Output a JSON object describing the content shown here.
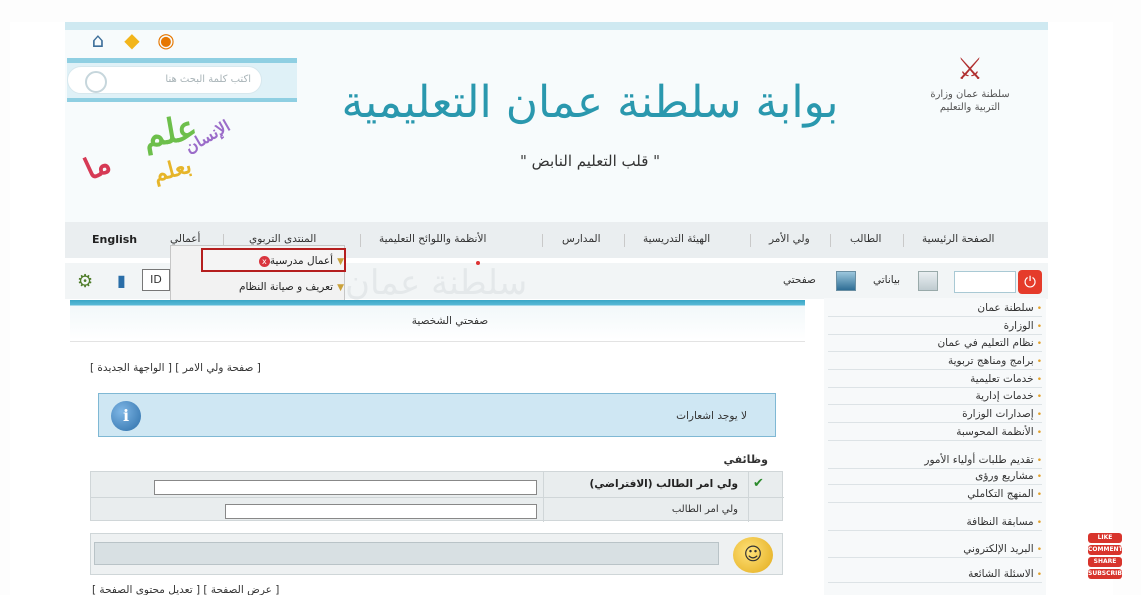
{
  "header": {
    "portal_title": "بوابة سلطنة عمان التعليمية",
    "tagline": "\" قلب التعليم النابض \"",
    "search_placeholder": "اكتب كلمة البحث هنا",
    "ministry_name": "سلطنة عمان وزارة التربية والتعليم",
    "calligraphy": [
      "علم",
      "الإنسان",
      "بعلم",
      "ما"
    ]
  },
  "nav": {
    "english": "English",
    "items": [
      "أعمالي",
      "المنتدى التربوي",
      "الأنظمة واللوائح التعليمية",
      "المدارس",
      "الهيئة التدريسية",
      "ولي الأمر",
      "الطالب",
      "الصفحة الرئيسية"
    ]
  },
  "dropdown": {
    "items": [
      "أعمال مدرسية",
      "تعريف و صيانة النظام"
    ]
  },
  "tools": {
    "my_data": "بياناتي",
    "my_page": "صفحتي",
    "watermark": "سلطنة عمان",
    "card_label": "ID"
  },
  "sidebar": {
    "items": [
      "سلطنة عمان",
      "الوزارة",
      "نظام التعليم في عمان",
      "برامج ومناهج تربوية",
      "خدمات تعليمية",
      "خدمات إدارية",
      "إصدارات الوزارة",
      "الأنظمة المحوسبة",
      "تقديم طلبات أولياء الأمور",
      "مشاريع ورؤى",
      "المنهج التكاملي",
      "مسابقة النظافة",
      "البريد الإلكتروني",
      "الاسئلة الشائعة"
    ]
  },
  "main": {
    "title": "صفحتي الشخصية",
    "links": "[ صفحة ولي الامر ]   [ الواجهة الجديدة ]",
    "notice": "لا يوجد اشعارات",
    "jobs_title": "وظائفي",
    "role_default": "ولي امر الطالب (الافتراضي)",
    "role_other": "ولي امر الطالب",
    "footer_links": "[ عرض الصفحة ] [ تعديل محتوى الصفحة ]"
  },
  "social": [
    "LIKE",
    "COMMENT",
    "SHARE",
    "SUBSCRIBE"
  ],
  "colors": {
    "accent_teal": "#2a98ae",
    "highlight_red": "#b51e1e",
    "power_red": "#e53b2a"
  },
  "icons": [
    "info-icon",
    "home-icon",
    "folder-icon",
    "rss-icon",
    "search-icon",
    "gear-icon",
    "mobile-icon",
    "id-card-icon",
    "power-icon",
    "close-icon",
    "chevron-down-icon",
    "info-notice-icon",
    "smiley-icon"
  ]
}
